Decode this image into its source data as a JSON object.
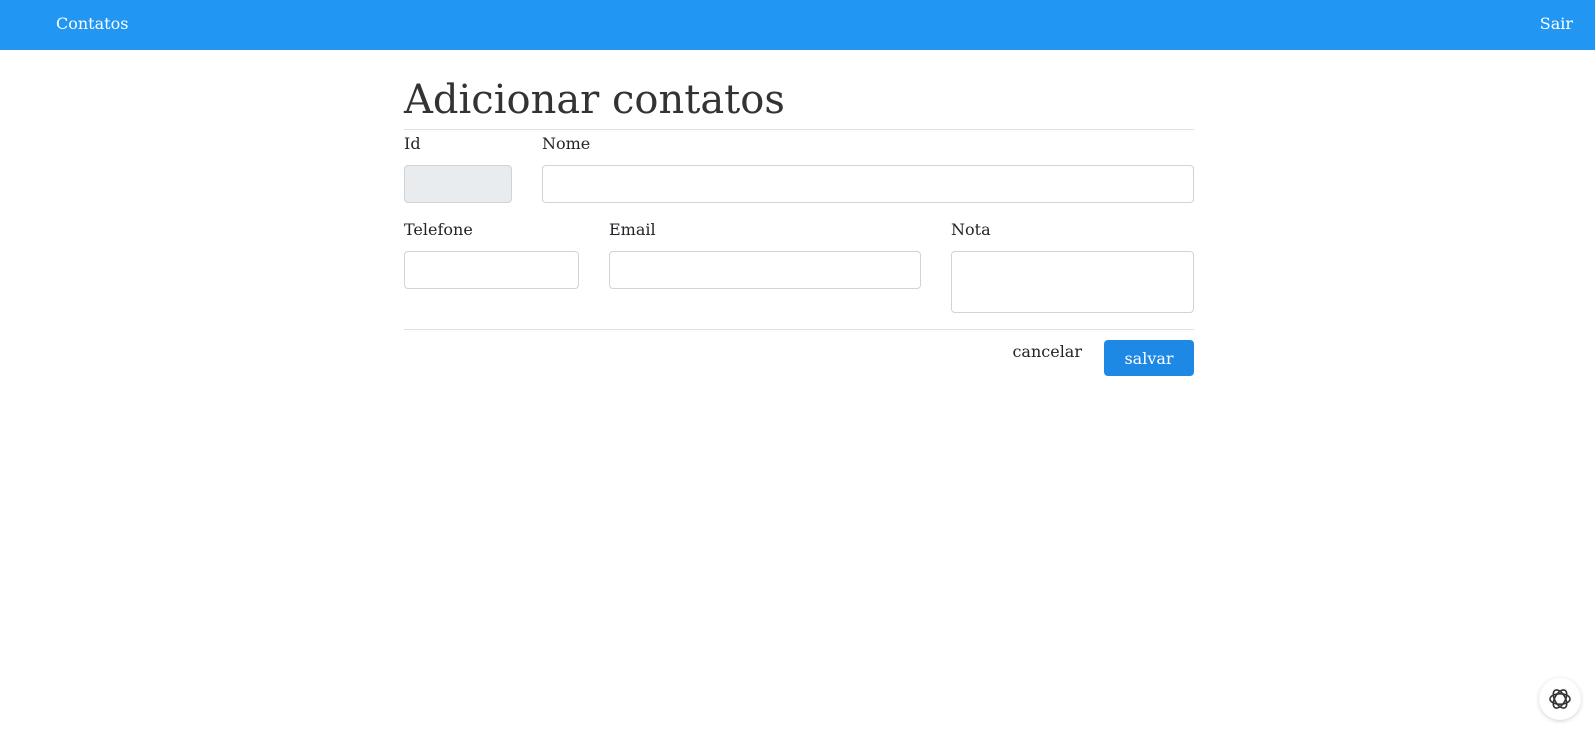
{
  "navbar": {
    "brand": "Contatos",
    "logout": "Sair",
    "background_color": "#2196f3"
  },
  "page": {
    "title": "Adicionar contatos"
  },
  "form": {
    "id": {
      "label": "Id",
      "value": ""
    },
    "nome": {
      "label": "Nome",
      "value": ""
    },
    "telefone": {
      "label": "Telefone",
      "value": ""
    },
    "email": {
      "label": "Email",
      "value": ""
    },
    "nota": {
      "label": "Nota",
      "value": ""
    }
  },
  "actions": {
    "cancel_label": "cancelar",
    "save_label": "salvar",
    "save_color": "#1e88e5"
  },
  "floating": {
    "icon": "openai-knot-icon"
  }
}
